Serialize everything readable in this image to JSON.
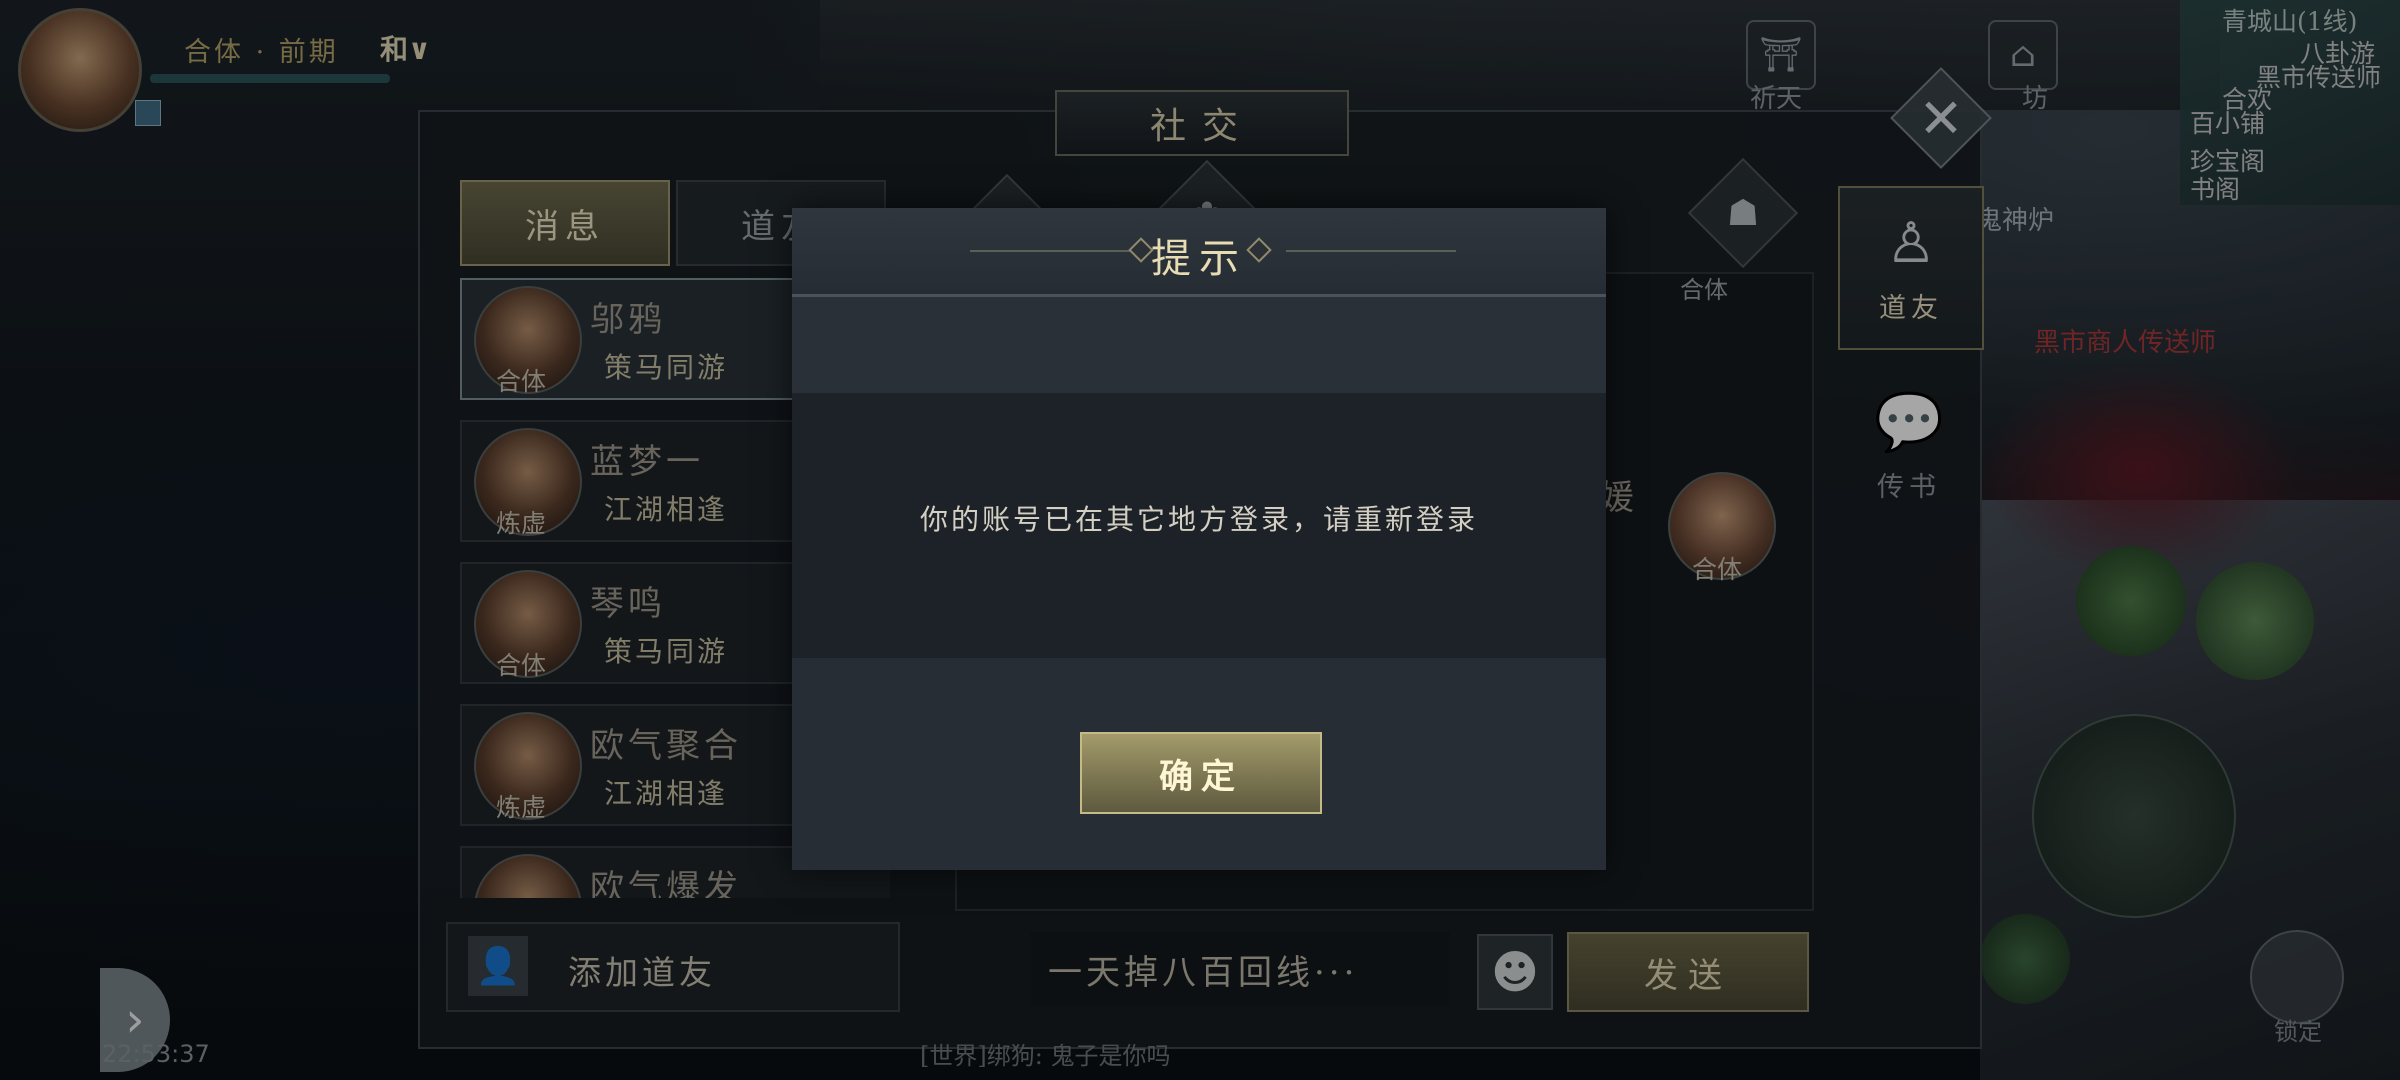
{
  "hud": {
    "realm": "合体 · 前期",
    "mode": "和∨",
    "top_icons": [
      {
        "label": "祈天",
        "icon": "altar-icon"
      },
      {
        "label": "坊",
        "icon": "pavilion-icon"
      },
      {
        "label": "鬼神炉",
        "icon": "furnace-icon"
      }
    ],
    "clock": "22:53:37",
    "lock_label": "锁定"
  },
  "minimap": {
    "title": "青城山(1线)",
    "npcs": [
      "八卦游",
      "黑市传送师",
      "合欢",
      "百小铺",
      "珍宝阁",
      "书阁"
    ],
    "npc_red": "黑市商人传送师"
  },
  "social": {
    "title": "社交",
    "close_symbol": "✕",
    "tabs": [
      {
        "label": "消息",
        "active": true
      },
      {
        "label": "道友",
        "active": false
      }
    ],
    "friends": [
      {
        "name": "邬鸦",
        "relation": "策马同游",
        "realm": "合体"
      },
      {
        "name": "蓝梦一",
        "relation": "江湖相逢",
        "realm": "炼虚"
      },
      {
        "name": "琴鸣",
        "relation": "策马同游",
        "realm": "合体"
      },
      {
        "name": "欧气聚合",
        "relation": "江湖相逢",
        "realm": "炼虚"
      },
      {
        "name": "欧气爆发",
        "relation": "",
        "realm": ""
      }
    ],
    "add_friend_label": "添加道友",
    "chat": {
      "peer_name_partial": "媛",
      "peer_realm": "合体",
      "hidden_realm": "合体",
      "input_text": "一天掉八百回线···",
      "send_label": "发送"
    },
    "side_tabs": [
      {
        "label": "道友",
        "icon": "friend-figure-icon",
        "active": true
      },
      {
        "label": "传书",
        "icon": "message-bubble-icon",
        "active": false
      }
    ],
    "ticker": "[世界]绑狗: 鬼子是你吗"
  },
  "dialog": {
    "title": "提示",
    "message": "你的账号已在其它地方登录，请重新登录",
    "confirm_label": "确定"
  }
}
